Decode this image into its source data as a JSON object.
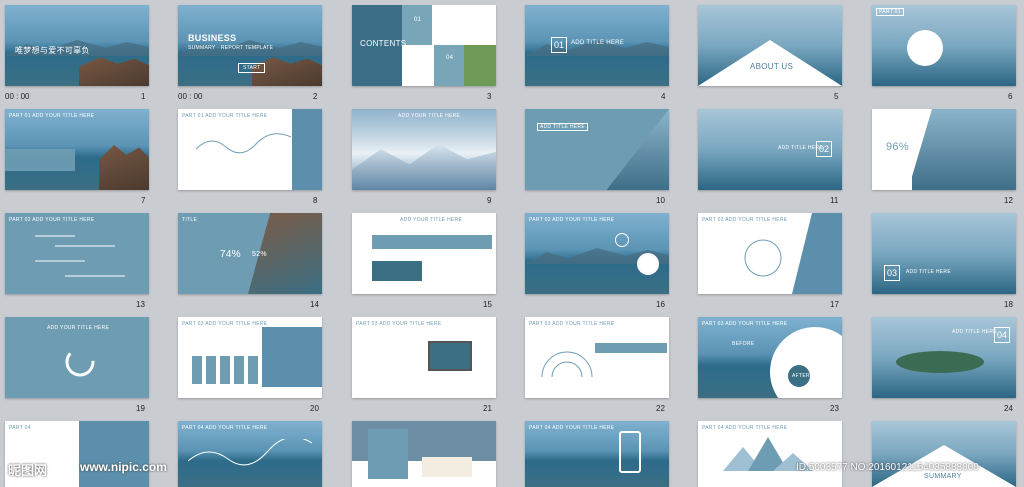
{
  "slides": [
    {
      "n": "1",
      "caption": "00 : 00",
      "text": "唯梦想与爱不可辜负"
    },
    {
      "n": "2",
      "caption": "00 : 00",
      "text": "BUSINESS",
      "text2": "SUMMARY · REPORT TEMPLATE",
      "text3": "START"
    },
    {
      "n": "3",
      "text": "CONTENTS",
      "text2": "01",
      "text3": "02",
      "text4": "03",
      "text5": "04"
    },
    {
      "n": "4",
      "text": "01",
      "text2": "ADD TITLE HERE"
    },
    {
      "n": "5",
      "text": "ABOUT US"
    },
    {
      "n": "6",
      "text": "PART 01"
    },
    {
      "n": "7",
      "text": "PART 01  ADD YOUR TITLE HERE"
    },
    {
      "n": "8",
      "text": "PART 01  ADD YOUR TITLE HERE"
    },
    {
      "n": "9",
      "text": "ADD YOUR TITLE HERE"
    },
    {
      "n": "10",
      "text": "ADD TITLE HERE"
    },
    {
      "n": "11",
      "text": "ADD TITLE HERE",
      "text2": "02"
    },
    {
      "n": "12",
      "text": "96%"
    },
    {
      "n": "13",
      "text": "PART 02  ADD YOUR TITLE HERE"
    },
    {
      "n": "14",
      "text": "74%",
      "text2": "52%",
      "text3": "TITLE"
    },
    {
      "n": "15",
      "text": "ADD YOUR TITLE HERE"
    },
    {
      "n": "16",
      "text": "PART 02  ADD YOUR TITLE HERE"
    },
    {
      "n": "17",
      "text": "PART 02  ADD YOUR TITLE HERE"
    },
    {
      "n": "18",
      "text": "03",
      "text2": "ADD TITLE HERE"
    },
    {
      "n": "19",
      "text": "ADD YOUR TITLE HERE"
    },
    {
      "n": "20",
      "text": "PART 03  ADD YOUR TITLE HERE"
    },
    {
      "n": "21",
      "text": "PART 03  ADD YOUR TITLE HERE"
    },
    {
      "n": "22",
      "text": "PART 03  ADD YOUR TITLE HERE"
    },
    {
      "n": "23",
      "text": "PART 03  ADD YOUR TITLE HERE",
      "text2": "BEFORE",
      "text3": "AFTER"
    },
    {
      "n": "24",
      "text": "ADD TITLE HERE",
      "text2": "04"
    },
    {
      "n": "",
      "text": "PART 04"
    },
    {
      "n": "",
      "text": "PART 04  ADD YOUR TITLE HERE"
    },
    {
      "n": "",
      "text": ""
    },
    {
      "n": "",
      "text": "PART 04  ADD YOUR TITLE HERE"
    },
    {
      "n": "",
      "text": "PART 04  ADD YOUR TITLE HERE"
    },
    {
      "n": "",
      "text": "SUMMARY"
    }
  ],
  "watermark": {
    "logo": "昵图网",
    "site": "www.nipic.com",
    "id": "ID:5003577 NO:20160121154035883000"
  }
}
